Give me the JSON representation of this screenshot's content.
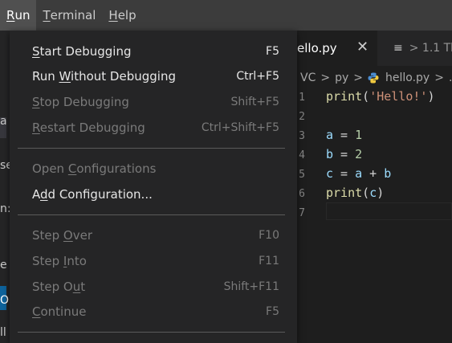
{
  "menubar": {
    "items": [
      {
        "pre": "",
        "u": "R",
        "post": "un",
        "active": true
      },
      {
        "pre": "",
        "u": "T",
        "post": "erminal",
        "active": false
      },
      {
        "pre": "",
        "u": "H",
        "post": "elp",
        "active": false
      }
    ]
  },
  "run_menu": {
    "start_debugging": {
      "pre": "",
      "u": "S",
      "post": "tart Debugging",
      "shortcut": "F5"
    },
    "run_without_debugging": {
      "pre": "Run ",
      "u": "W",
      "post": "ithout Debugging",
      "shortcut": "Ctrl+F5"
    },
    "stop_debugging": {
      "pre": "",
      "u": "S",
      "post": "top Debugging",
      "shortcut": "Shift+F5"
    },
    "restart_debugging": {
      "pre": "",
      "u": "R",
      "post": "estart Debugging",
      "shortcut": "Ctrl+Shift+F5"
    },
    "open_configurations": {
      "pre": "Open ",
      "u": "C",
      "post": "onfigurations",
      "shortcut": ""
    },
    "add_configuration": {
      "pre": "A",
      "u": "d",
      "post": "d Configuration...",
      "shortcut": ""
    },
    "step_over": {
      "pre": "Step ",
      "u": "O",
      "post": "ver",
      "shortcut": "F10"
    },
    "step_into": {
      "pre": "Step ",
      "u": "I",
      "post": "nto",
      "shortcut": "F11"
    },
    "step_out": {
      "pre": "Step O",
      "u": "u",
      "post": "t",
      "shortcut": "Shift+F11"
    },
    "continue": {
      "pre": "",
      "u": "C",
      "post": "ontinue",
      "shortcut": "F5"
    }
  },
  "editor": {
    "active_tab": {
      "label": "ello.py",
      "close": "✕"
    },
    "inactive_tab": {
      "icon": "≡",
      "label": "> 1.1 Th"
    },
    "breadcrumbs": {
      "part1": "VC",
      "sep": ">",
      "part2": "py",
      "file": "hello.py",
      "tail": "..."
    },
    "line_numbers": [
      "1",
      "2",
      "3",
      "4",
      "5",
      "6",
      "7"
    ],
    "code": {
      "l1": {
        "fn": "print",
        "p1": "(",
        "str": "'Hello!'",
        "p2": ")"
      },
      "l3": {
        "var": "a",
        "op": " = ",
        "num": "1"
      },
      "l4": {
        "var": "b",
        "op": " = ",
        "num": "2"
      },
      "l5": {
        "var": "c",
        "op": " = ",
        "v2": "a",
        "op2": " + ",
        "v3": "b"
      },
      "l6": {
        "fn": "print",
        "p1": "(",
        "var": "c",
        "p2": ")"
      }
    }
  },
  "left_fragments": [
    "a",
    "se",
    "n:",
    "e",
    "Op",
    "ll"
  ],
  "colors": {
    "accent": "#0e639c",
    "menu_bg": "#252526",
    "menubar_bg": "#3c3c3c"
  }
}
